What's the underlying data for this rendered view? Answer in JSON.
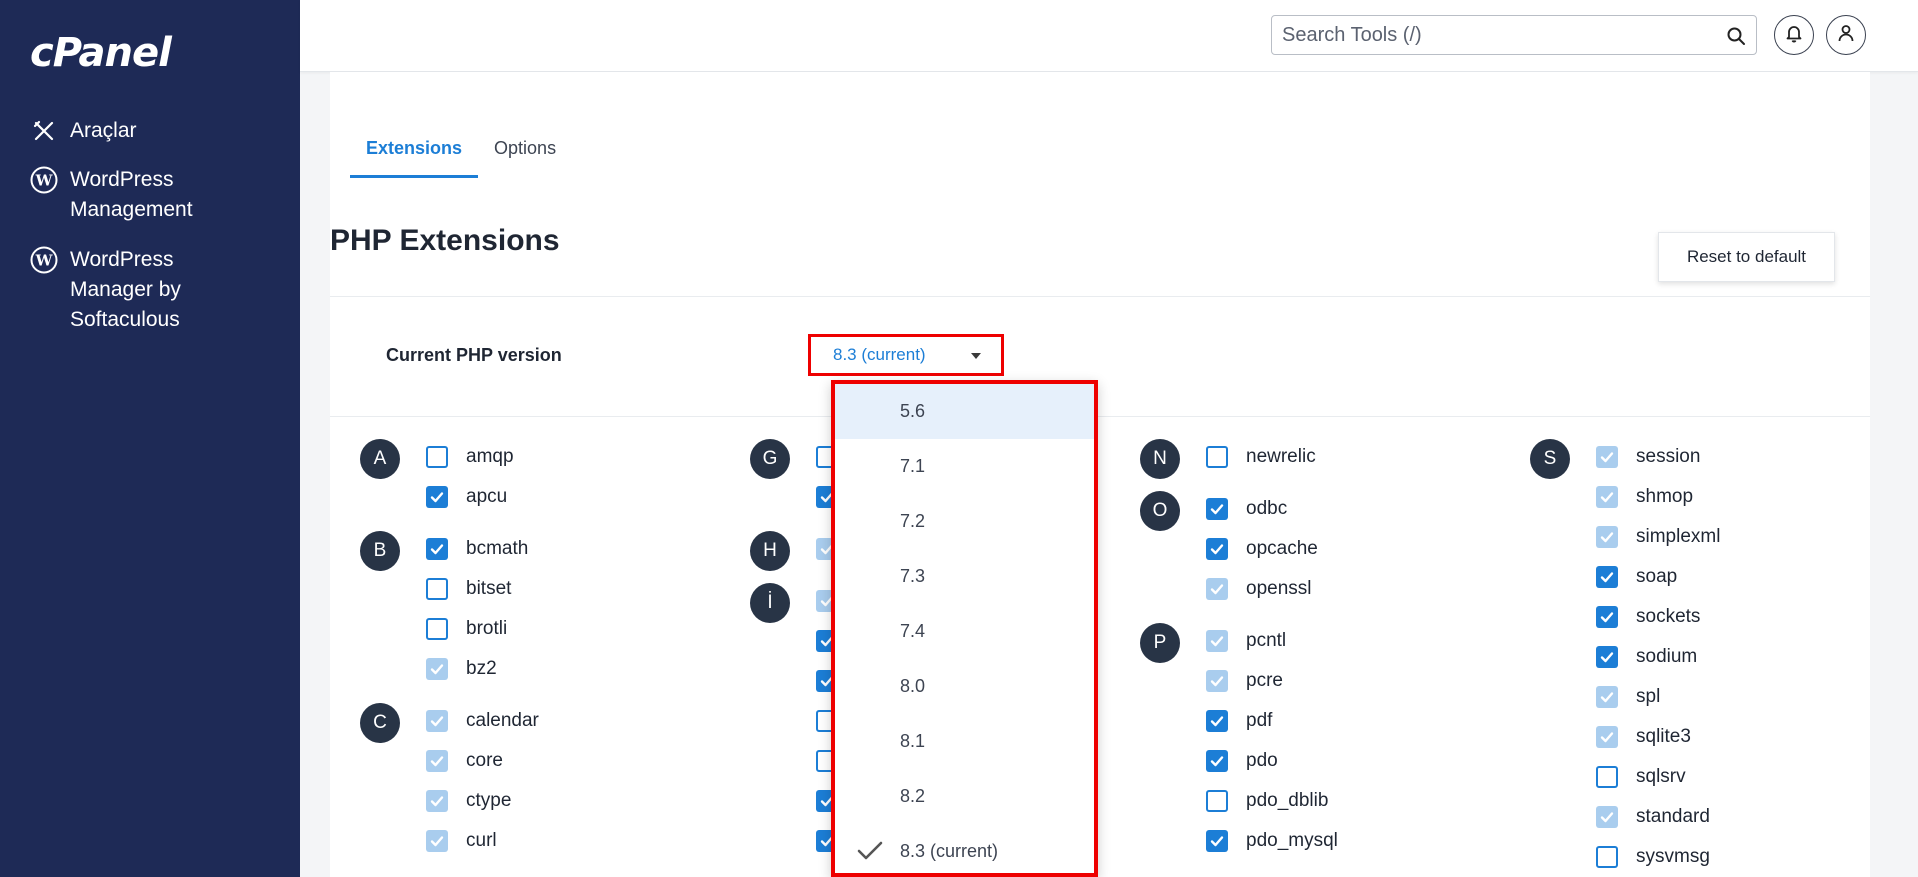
{
  "sidebar": {
    "logo": "cPanel",
    "items": [
      {
        "label": "Araçlar",
        "icon": "tools-icon"
      },
      {
        "label": "WordPress\nManagement",
        "icon": "wordpress-icon"
      },
      {
        "label": "WordPress\nManager by\nSoftaculous",
        "icon": "wordpress-icon"
      }
    ]
  },
  "topbar": {
    "search_placeholder": "Search Tools (/)",
    "icons": [
      "search-icon",
      "bell-icon",
      "user-icon"
    ]
  },
  "tabs": [
    "Extensions",
    "Options"
  ],
  "active_tab": "Extensions",
  "page_title": "PHP Extensions",
  "reset_label": "Reset to default",
  "php_version_label": "Current PHP version",
  "php_version_value": "8.3 (current)",
  "version_options": [
    "5.6",
    "7.1",
    "7.2",
    "7.3",
    "7.4",
    "8.0",
    "8.1",
    "8.2",
    "8.3 (current)"
  ],
  "selected_version": "8.3 (current)",
  "highlighted_version": "5.6",
  "colors": {
    "accent": "#1c7ed6",
    "sidebar": "#1e2a56",
    "highlight_border": "#ee0000"
  },
  "columns": [
    {
      "groups": [
        {
          "letter": "A",
          "items": [
            {
              "name": "amqp",
              "state": "unchecked"
            },
            {
              "name": "apcu",
              "state": "checked"
            }
          ]
        },
        {
          "letter": "B",
          "items": [
            {
              "name": "bcmath",
              "state": "checked"
            },
            {
              "name": "bitset",
              "state": "unchecked"
            },
            {
              "name": "brotli",
              "state": "unchecked"
            },
            {
              "name": "bz2",
              "state": "checked-disabled"
            }
          ]
        },
        {
          "letter": "C",
          "items": [
            {
              "name": "calendar",
              "state": "checked-disabled"
            },
            {
              "name": "core",
              "state": "checked-disabled"
            },
            {
              "name": "ctype",
              "state": "checked-disabled"
            },
            {
              "name": "curl",
              "state": "checked-disabled"
            }
          ]
        }
      ]
    },
    {
      "groups": [
        {
          "letter": "G",
          "items": [
            {
              "name": "",
              "state": "unchecked"
            },
            {
              "name": "",
              "state": "checked"
            }
          ]
        },
        {
          "letter": "H",
          "items": [
            {
              "name": "",
              "state": "checked-disabled"
            }
          ]
        },
        {
          "letter": "İ",
          "items": [
            {
              "name": "",
              "state": "checked-disabled"
            },
            {
              "name": "",
              "state": "checked"
            },
            {
              "name": "",
              "state": "checked"
            },
            {
              "name": "",
              "state": "unchecked"
            },
            {
              "name": "",
              "state": "unchecked"
            },
            {
              "name": "",
              "state": "checked"
            },
            {
              "name": "",
              "state": "checked"
            }
          ]
        }
      ]
    },
    {
      "groups": [
        {
          "letter": "N",
          "items": [
            {
              "name": "newrelic",
              "state": "unchecked"
            }
          ]
        },
        {
          "letter": "O",
          "items": [
            {
              "name": "odbc",
              "state": "checked"
            },
            {
              "name": "opcache",
              "state": "checked"
            },
            {
              "name": "openssl",
              "state": "checked-disabled"
            }
          ]
        },
        {
          "letter": "P",
          "items": [
            {
              "name": "pcntl",
              "state": "checked-disabled"
            },
            {
              "name": "pcre",
              "state": "checked-disabled"
            },
            {
              "name": "pdf",
              "state": "checked"
            },
            {
              "name": "pdo",
              "state": "checked"
            },
            {
              "name": "pdo_dblib",
              "state": "unchecked"
            },
            {
              "name": "pdo_mysql",
              "state": "checked"
            }
          ]
        }
      ]
    },
    {
      "groups": [
        {
          "letter": "S",
          "items": [
            {
              "name": "session",
              "state": "checked-disabled"
            },
            {
              "name": "shmop",
              "state": "checked-disabled"
            },
            {
              "name": "simplexml",
              "state": "checked-disabled"
            },
            {
              "name": "soap",
              "state": "checked"
            },
            {
              "name": "sockets",
              "state": "checked"
            },
            {
              "name": "sodium",
              "state": "checked"
            },
            {
              "name": "spl",
              "state": "checked-disabled"
            },
            {
              "name": "sqlite3",
              "state": "checked-disabled"
            },
            {
              "name": "sqlsrv",
              "state": "unchecked"
            },
            {
              "name": "standard",
              "state": "checked-disabled"
            },
            {
              "name": "sysvmsg",
              "state": "unchecked"
            }
          ]
        }
      ]
    }
  ]
}
